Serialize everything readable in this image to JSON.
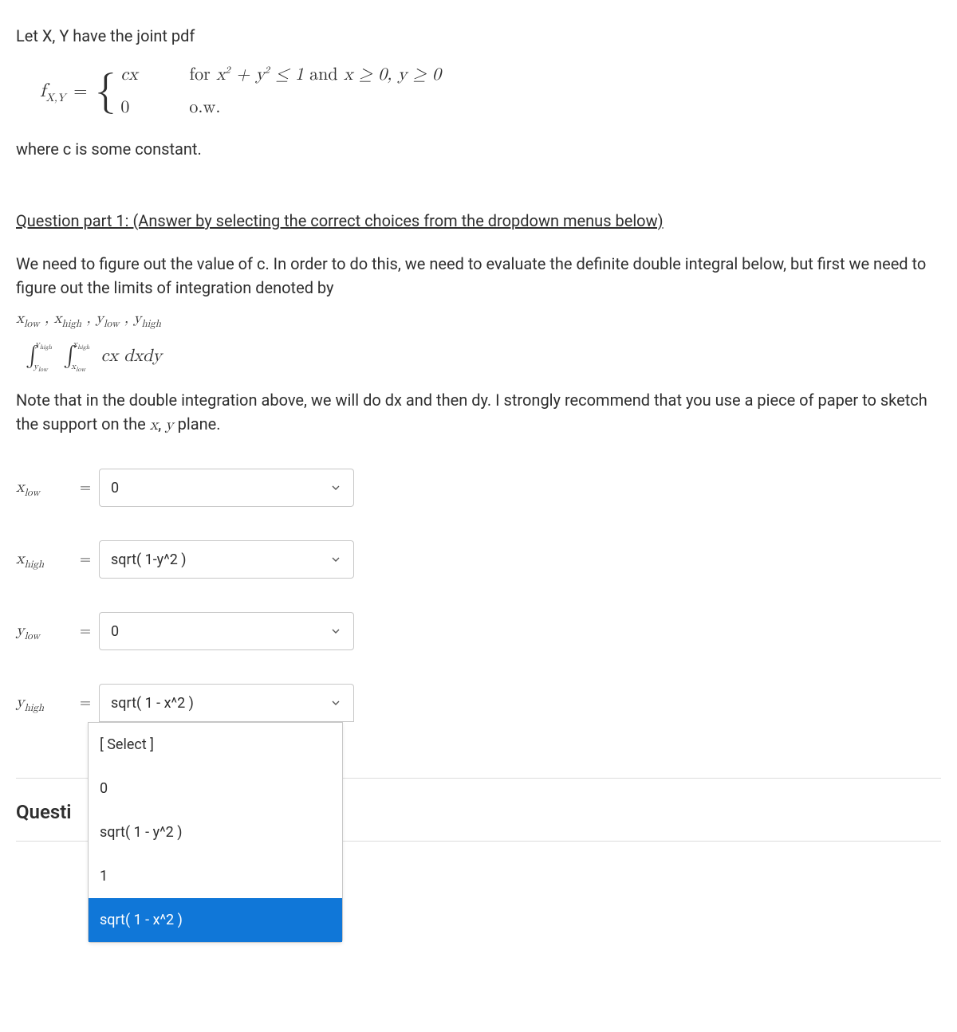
{
  "intro": "Let X, Y have the joint pdf",
  "formula": {
    "lhs": "f",
    "lhs_sub": "X,Y",
    "case1_left": "cx",
    "case1_right_prefix": "for ",
    "case1_right_math": "x² + y² ≤ 1 and x ≥ 0, y ≥ 0",
    "case2_left": "0",
    "case2_right": "o.w."
  },
  "where": "where c is some constant.",
  "q1_heading": "Question part 1:   (Answer by selecting the correct choices from the dropdown menus below)",
  "para1": "We need to figure out the value of c.  In order to do this, we need to evaluate the definite double integral below, but first we need to figure out the limits of integration denoted by",
  "vars_line": "xlow , xhigh , ylow , yhigh",
  "integral": {
    "y_low": "ylow",
    "y_high": "yhigh",
    "x_low": "xlow",
    "x_high": "xhigh",
    "integrand": "cx dxdy"
  },
  "note": "Note that in the double integration above, we will do dx and then dy. I strongly recommend that you use a piece of paper to sketch the support on the x, y plane.",
  "answers": {
    "xlow": {
      "label": "x",
      "sub": "low",
      "value": "0"
    },
    "xhigh": {
      "label": "x",
      "sub": "high",
      "value": "sqrt( 1-y^2 )"
    },
    "ylow": {
      "label": "y",
      "sub": "low",
      "value": "0"
    },
    "yhigh": {
      "label": "y",
      "sub": "high",
      "value": "sqrt( 1 - x^2 )"
    }
  },
  "dropdown_options": {
    "placeholder": "[ Select ]",
    "opt1": "0",
    "opt2": "sqrt( 1 - y^2 )",
    "opt3": "1",
    "opt4": "sqrt( 1 - x^2 )"
  },
  "bottom_cutoff": "Questi"
}
